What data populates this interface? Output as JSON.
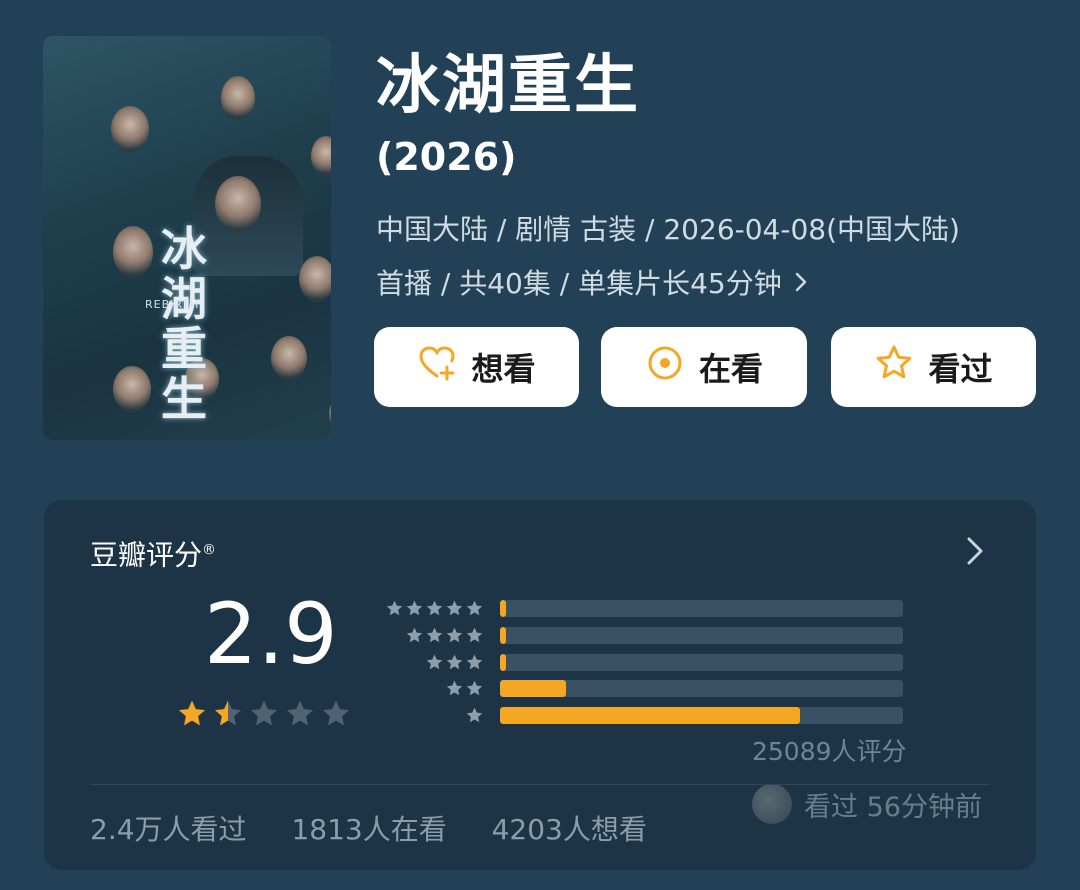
{
  "show": {
    "title": "冰湖重生",
    "year": "(2026)",
    "meta_line1": "中国大陆 / 剧情 古装 / 2026-04-08(中国大陆)",
    "meta_line2": "首播 / 共40集 / 单集片长45分钟",
    "poster_title": "冰湖重生",
    "poster_subtitle": "REBIRTH"
  },
  "actions": {
    "want_label": "想看",
    "watching_label": "在看",
    "watched_label": "看过"
  },
  "rating": {
    "header": "豆瓣评分",
    "header_mark": "®",
    "score": "2.9",
    "score_stars": 1.5,
    "distribution_percent": [
      1.5,
      1.5,
      1.5,
      16.5,
      74.5
    ],
    "rating_count": "25089人评分",
    "recent_watcher_text": "看过 56分钟前"
  },
  "stats": {
    "watched": "2.4万人看过",
    "watching": "1813人在看",
    "want": "4203人想看"
  },
  "colors": {
    "background": "#234156",
    "card": "#1d3446",
    "accent": "#f5a623",
    "track": "#3a5063"
  },
  "icons": {
    "want": "heart-plus-icon",
    "watching": "target-circle-icon",
    "watched": "star-outline-icon",
    "more": "chevron-right-icon"
  }
}
